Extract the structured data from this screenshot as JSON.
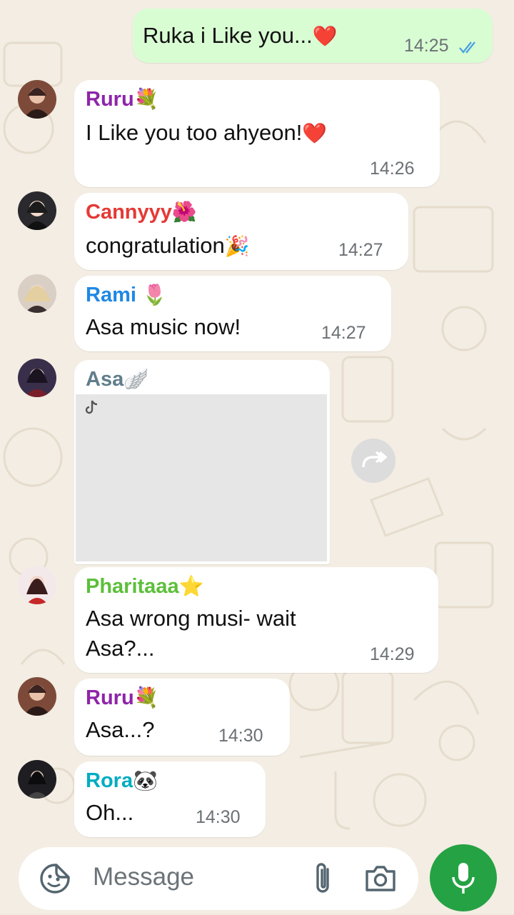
{
  "colors": {
    "outgoing_bubble": "#d9fdd3",
    "incoming_bubble": "#ffffff",
    "wallpaper": "#f3ede3",
    "read_ticks": "#4fa3e0",
    "mic_button": "#25a244"
  },
  "outgoing": {
    "text": "Ruka i Like you...",
    "emoji": "❤️",
    "time": "14:25",
    "status_icon": "double-check-read-icon"
  },
  "messages": [
    {
      "sender": "Ruru",
      "sender_emoji": "💐",
      "sender_color": "#8e24aa",
      "text": "I Like you too ahyeon!",
      "text_emoji": "❤️",
      "time": "14:26"
    },
    {
      "sender": "Cannyyy",
      "sender_emoji": "🌺",
      "sender_color": "#e53935",
      "text": "congratulation",
      "text_emoji": "🎉",
      "time": "14:27"
    },
    {
      "sender": "Rami",
      "sender_emoji": "🌷",
      "sender_color": "#1e88e5",
      "text": "Asa music now!",
      "time": "14:27"
    },
    {
      "sender": "Asa",
      "sender_emoji": "🪽",
      "sender_color": "#607d8b",
      "media": "video",
      "media_icon": "tiktok-logo-icon"
    },
    {
      "sender": "Pharitaaa",
      "sender_emoji": "⭐",
      "sender_color": "#5cbf3a",
      "text_line1": "Asa wrong musi- wait",
      "text_line2": "Asa?...",
      "time": "14:29"
    },
    {
      "sender": "Ruru",
      "sender_emoji": "💐",
      "sender_color": "#8e24aa",
      "text": "Asa...?",
      "time": "14:30"
    },
    {
      "sender": "Rora",
      "sender_emoji": "🐼",
      "sender_color": "#00acc1",
      "text": "Oh...",
      "time": "14:30"
    }
  ],
  "composer": {
    "placeholder": "Message",
    "emoji_icon": "sticker-smiley-icon",
    "attach_icon": "paperclip-icon",
    "camera_icon": "camera-icon",
    "mic_icon": "microphone-icon"
  },
  "forward_icon": "forward-icon"
}
